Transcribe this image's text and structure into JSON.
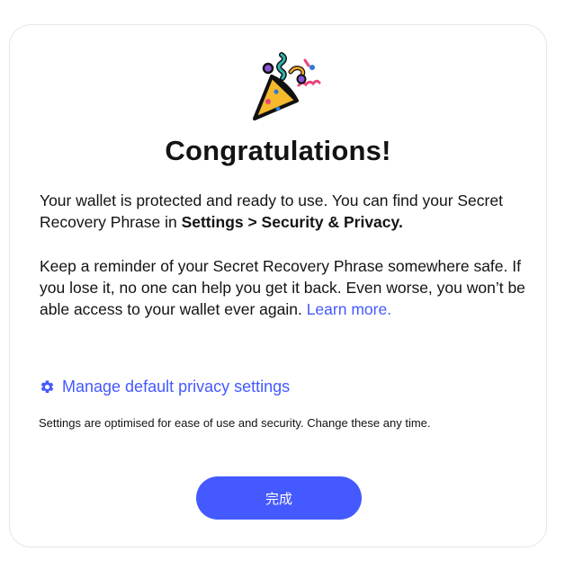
{
  "hero": {
    "icon": "party-popper-icon"
  },
  "title": "Congratulations!",
  "body": {
    "p1_text": "Your wallet is protected and ready to use. You can find your Secret Recovery Phrase in ",
    "p1_bold": "Settings > Security & Privacy.",
    "p2_text": "Keep a reminder of your Secret Recovery Phrase somewhere safe. If you lose it, no one can help you get it back. Even worse, you won’t be able access to your wallet ever again.",
    "learn_more": "Learn more."
  },
  "privacy": {
    "icon": "gear-icon",
    "label": "Manage default privacy settings",
    "note": "Settings are optimised for ease of use and security. Change these any time."
  },
  "done_button": "完成",
  "colors": {
    "accent": "#4459ff",
    "text": "#121314",
    "border": "#e4e6ea"
  }
}
